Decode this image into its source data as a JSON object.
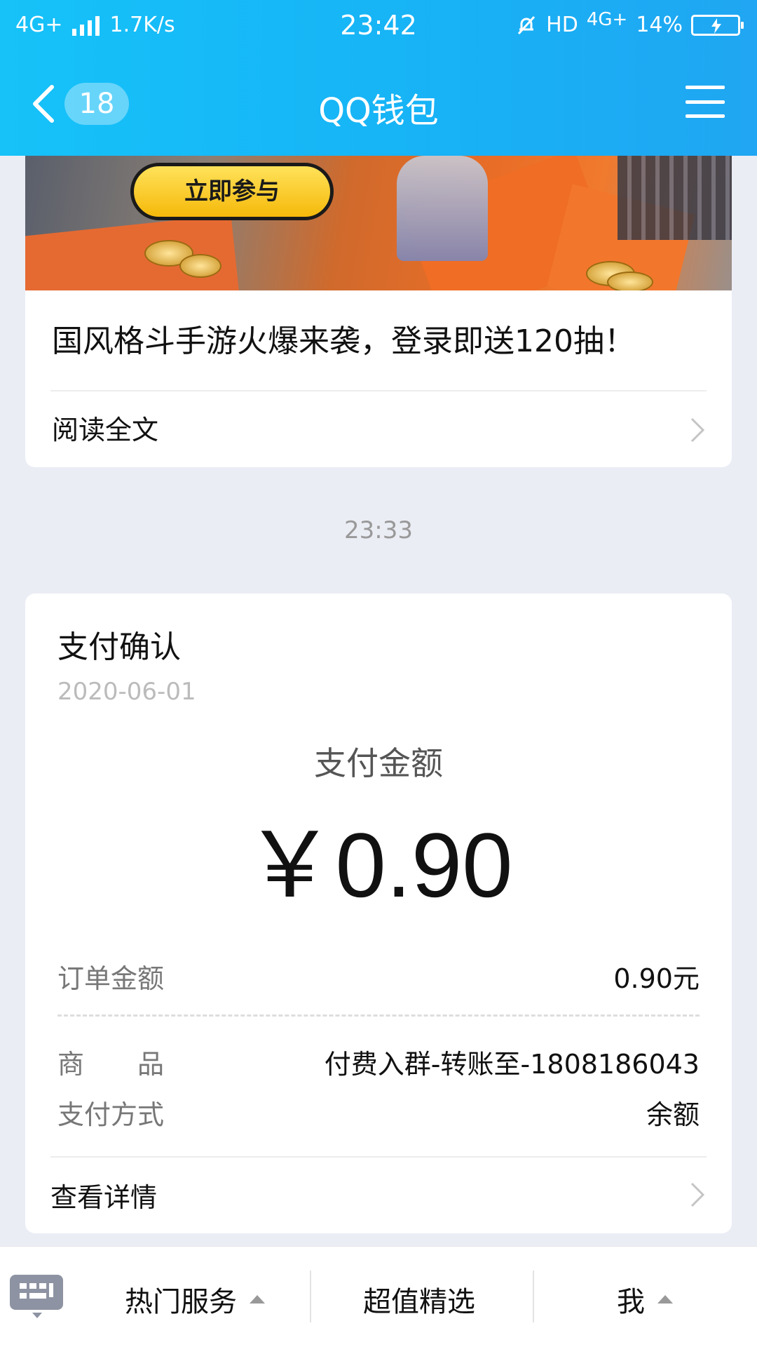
{
  "status_bar": {
    "network": "4G+",
    "speed": "1.7K/s",
    "time": "23:42",
    "hd": "HD",
    "network2": "4G+",
    "battery": "14%"
  },
  "nav": {
    "unread_count": "18",
    "title": "QQ钱包"
  },
  "article": {
    "banner_cta": "立即参与",
    "title": "国风格斗手游火爆来袭，登录即送120抽！",
    "read_more": "阅读全文"
  },
  "timestamp": "23:33",
  "payment": {
    "title": "支付确认",
    "date": "2020-06-01",
    "amount_label": "支付金额",
    "amount": "￥0.90",
    "order_amount_label": "订单金额",
    "order_amount_value": "0.90元",
    "product_label": "商　　品",
    "product_value": "付费入群-转账至-1808186043",
    "method_label": "支付方式",
    "method_value": "余额",
    "details_link": "查看详情"
  },
  "bottom_bar": {
    "tab1": "热门服务",
    "tab2": "超值精选",
    "tab3": "我"
  },
  "colors": {
    "header_start": "#16c2f8",
    "header_end": "#20a6f2",
    "page_background": "#ebedf5"
  }
}
